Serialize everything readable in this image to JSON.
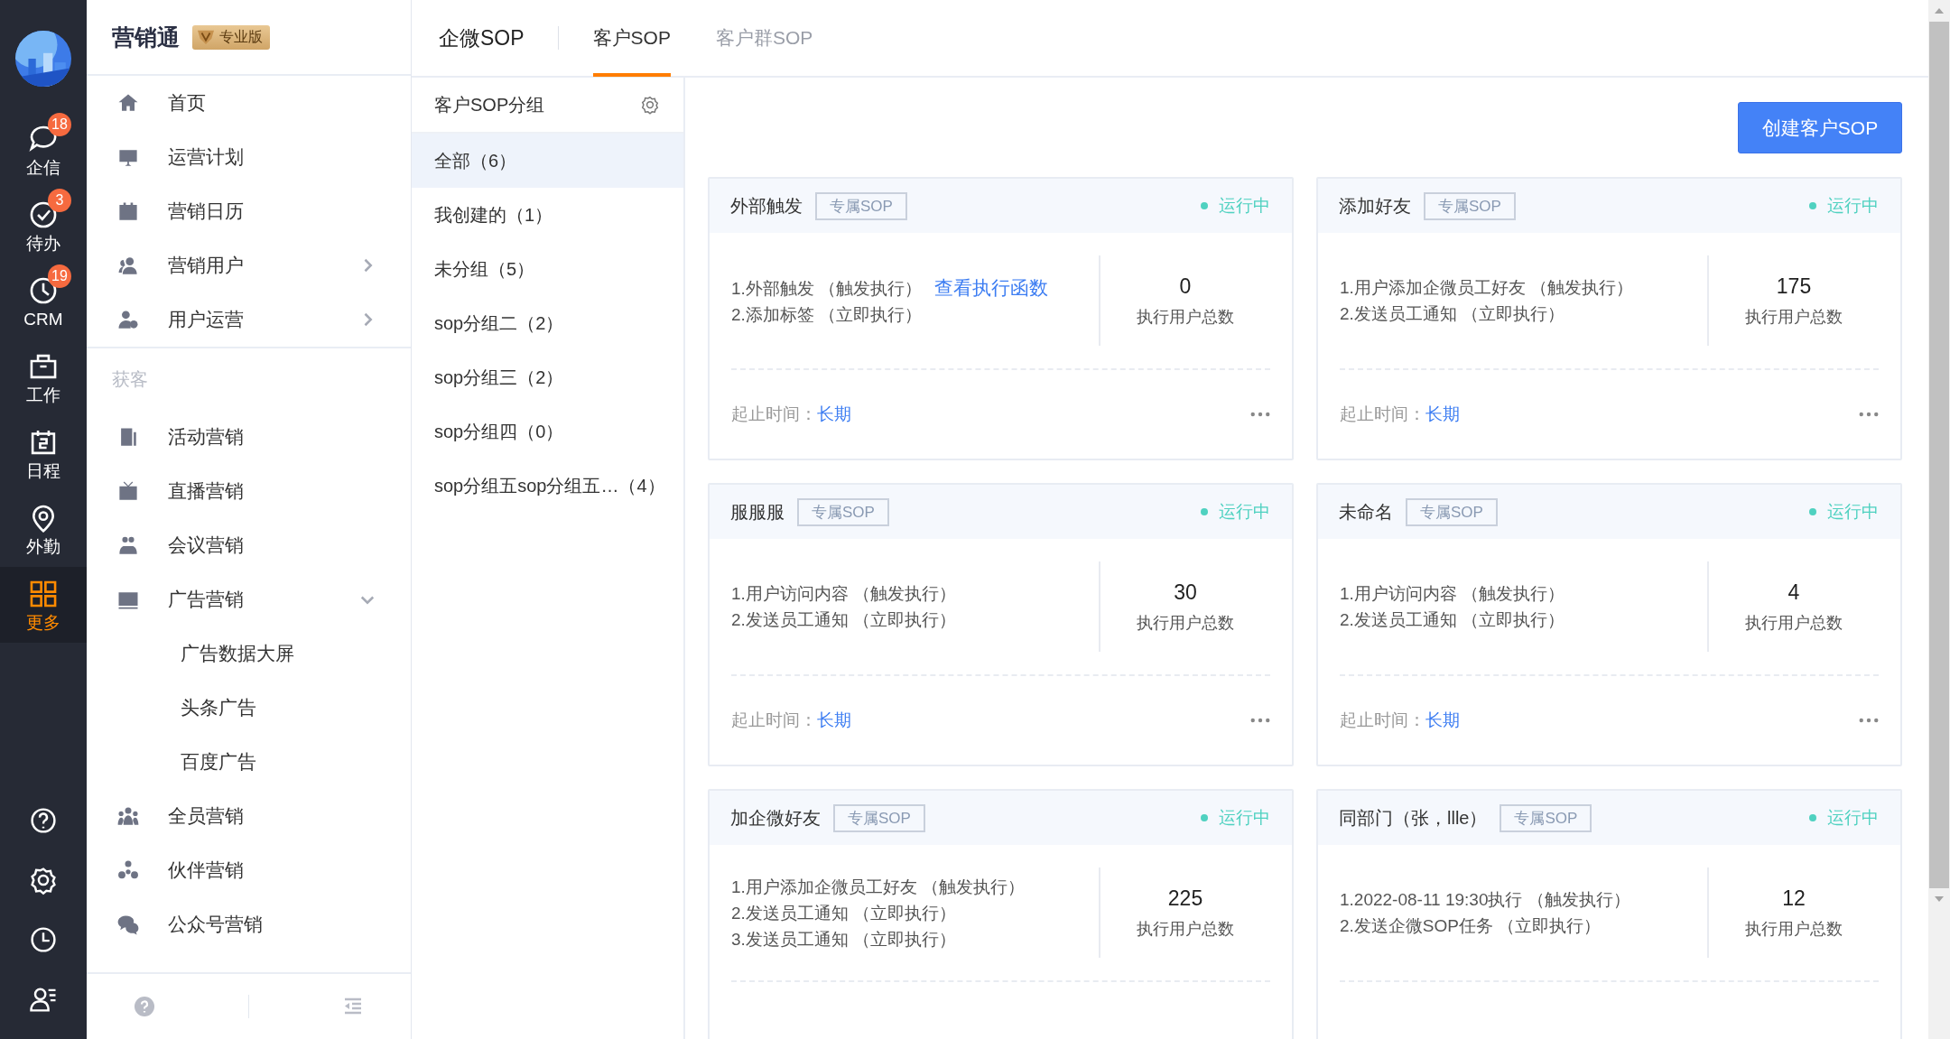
{
  "rail": {
    "items": [
      {
        "label": "企信",
        "badge": "18",
        "selected": false
      },
      {
        "label": "待办",
        "badge": "3",
        "selected": false
      },
      {
        "label": "CRM",
        "badge": "19",
        "selected": false
      },
      {
        "label": "工作",
        "selected": false
      },
      {
        "label": "日程",
        "selected": false
      },
      {
        "label": "外勤",
        "selected": false
      },
      {
        "label": "更多",
        "selected": true
      }
    ]
  },
  "nav": {
    "brand": "营销通",
    "edition": "专业版",
    "groups": [
      {
        "items": [
          {
            "label": "首页"
          },
          {
            "label": "运营计划"
          },
          {
            "label": "营销日历"
          },
          {
            "label": "营销用户",
            "expanded": false
          },
          {
            "label": "用户运营",
            "expanded": false
          }
        ]
      },
      {
        "heading": "获客",
        "items": [
          {
            "label": "活动营销"
          },
          {
            "label": "直播营销"
          },
          {
            "label": "会议营销"
          },
          {
            "label": "广告营销",
            "expanded": true,
            "children": [
              {
                "label": "广告数据大屏"
              },
              {
                "label": "头条广告"
              },
              {
                "label": "百度广告"
              }
            ]
          },
          {
            "label": "全员营销"
          },
          {
            "label": "伙伴营销"
          },
          {
            "label": "公众号营销"
          }
        ]
      }
    ]
  },
  "page_title": "企微SOP",
  "tabs": [
    {
      "label": "客户SOP",
      "selected": true
    },
    {
      "label": "客户群SOP",
      "selected": false
    }
  ],
  "groups_panel": {
    "title": "客户SOP分组",
    "items": [
      {
        "label": "全部（6）",
        "selected": true
      },
      {
        "label": "我创建的（1）",
        "selected": false
      },
      {
        "label": "未分组（5）",
        "selected": false
      },
      {
        "label": "sop分组二（2）",
        "selected": false
      },
      {
        "label": "sop分组三（2）",
        "selected": false
      },
      {
        "label": "sop分组四（0）",
        "selected": false
      },
      {
        "label": "sop分组五sop分组五…（4）",
        "selected": false
      }
    ]
  },
  "create_button": "创建客户SOP",
  "cards": [
    {
      "title": "外部触发",
      "tag": "专属SOP",
      "status": "运行中",
      "steps": [
        {
          "text": "1.外部触发 （触发执行）",
          "link": "查看执行函数"
        },
        {
          "text": "2.添加标签 （立即执行）"
        }
      ],
      "count": "0",
      "count_label": "执行用户总数",
      "period_label": "起止时间：",
      "period": "长期"
    },
    {
      "title": "添加好友",
      "tag": "专属SOP",
      "status": "运行中",
      "steps": [
        {
          "text": "1.用户添加企微员工好友 （触发执行）"
        },
        {
          "text": "2.发送员工通知 （立即执行）"
        }
      ],
      "count": "175",
      "count_label": "执行用户总数",
      "period_label": "起止时间：",
      "period": "长期"
    },
    {
      "title": "服服服",
      "tag": "专属SOP",
      "status": "运行中",
      "steps": [
        {
          "text": "1.用户访问内容 （触发执行）"
        },
        {
          "text": "2.发送员工通知 （立即执行）"
        }
      ],
      "count": "30",
      "count_label": "执行用户总数",
      "period_label": "起止时间：",
      "period": "长期"
    },
    {
      "title": "未命名",
      "tag": "专属SOP",
      "status": "运行中",
      "steps": [
        {
          "text": "1.用户访问内容 （触发执行）"
        },
        {
          "text": "2.发送员工通知 （立即执行）"
        }
      ],
      "count": "4",
      "count_label": "执行用户总数",
      "period_label": "起止时间：",
      "period": "长期"
    },
    {
      "title": "加企微好友",
      "tag": "专属SOP",
      "status": "运行中",
      "steps": [
        {
          "text": "1.用户添加企微员工好友 （触发执行）"
        },
        {
          "text": "2.发送员工通知 （立即执行）"
        },
        {
          "text": "3.发送员工通知 （立即执行）"
        }
      ],
      "count": "225",
      "count_label": "执行用户总数"
    },
    {
      "title": "同部门（张，llle）",
      "tag": "专属SOP",
      "status": "运行中",
      "steps": [
        {
          "text": "1.2022-08-11 19:30执行 （触发执行）"
        },
        {
          "text": "2.发送企微SOP任务 （立即执行）"
        }
      ],
      "count": "12",
      "count_label": "执行用户总数"
    }
  ]
}
